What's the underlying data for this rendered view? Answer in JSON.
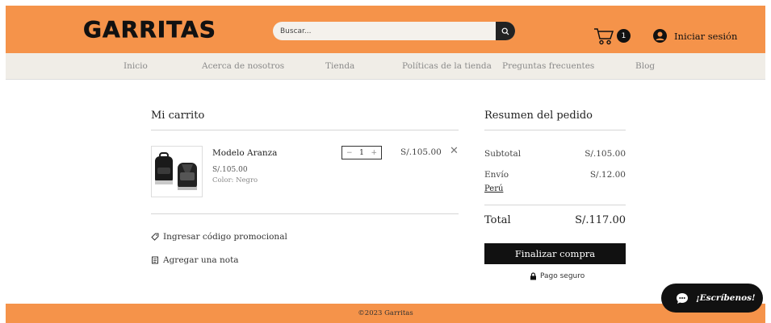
{
  "header": {
    "logo": "GARRITAS",
    "search_placeholder": "Buscar...",
    "cart_count": "1",
    "login_label": "Iniciar sesión"
  },
  "nav": {
    "items": [
      "Inicio",
      "Acerca de nosotros",
      "Tienda",
      "Políticas de la tienda",
      "Preguntas frecuentes",
      "Blog"
    ]
  },
  "cart": {
    "title": "Mi carrito",
    "item": {
      "name": "Modelo Aranza",
      "price": "S/.105.00",
      "color": "Color: Negro",
      "quantity": "1",
      "line_total": "S/.105.00"
    },
    "promo_label": "Ingresar código promocional",
    "note_label": "Agregar una nota"
  },
  "summary": {
    "title": "Resumen del pedido",
    "subtotal_label": "Subtotal",
    "subtotal_value": "S/.105.00",
    "shipping_label": "Envío",
    "shipping_value": "S/.12.00",
    "shipping_country": "Perú",
    "total_label": "Total",
    "total_value": "S/.117.00",
    "checkout_label": "Finalizar compra",
    "secure_label": "Pago seguro"
  },
  "footer": {
    "copyright": "©2023 Garritas"
  },
  "chat": {
    "label": "¡Escríbenos!"
  },
  "colors": {
    "brand_orange": "#f5934a",
    "nav_bg": "#f0ede7",
    "dark": "#111111"
  }
}
